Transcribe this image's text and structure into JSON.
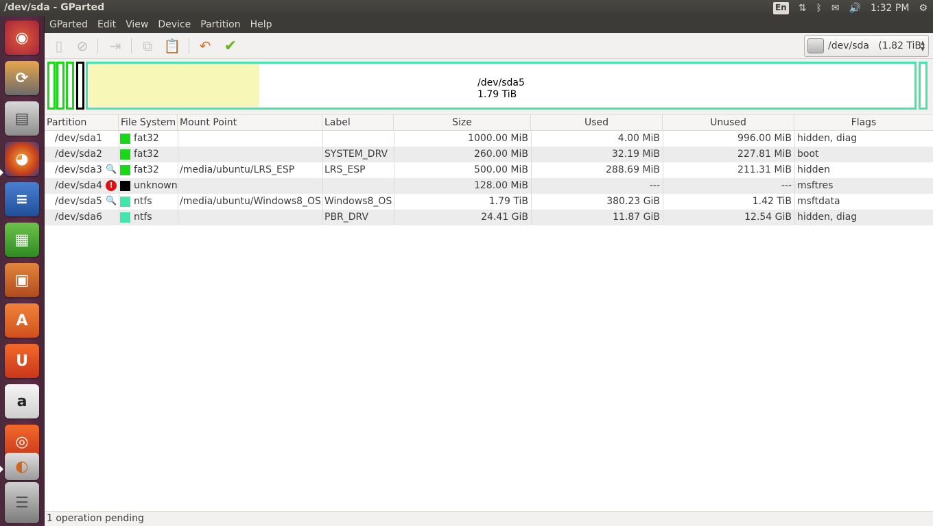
{
  "window_title": "/dev/sda - GParted",
  "indicators": {
    "keyboard": "En",
    "clock": "1:32 PM"
  },
  "menu": [
    "GParted",
    "Edit",
    "View",
    "Device",
    "Partition",
    "Help"
  ],
  "device_selector": {
    "value": "/dev/sda   (1.82 TiB)"
  },
  "disk_map": {
    "selected_name": "/dev/sda5",
    "selected_size": "1.79 TiB"
  },
  "table": {
    "headers": [
      "Partition",
      "File System",
      "Mount Point",
      "Label",
      "Size",
      "Used",
      "Unused",
      "Flags"
    ],
    "rows": [
      {
        "partition": "/dev/sda1",
        "fs": "fat32",
        "fs_color": "#18d818",
        "mount": "",
        "label": "",
        "size": "1000.00 MiB",
        "used": "4.00 MiB",
        "unused": "996.00 MiB",
        "flags": "hidden, diag",
        "icon": ""
      },
      {
        "partition": "/dev/sda2",
        "fs": "fat32",
        "fs_color": "#18d818",
        "mount": "",
        "label": "SYSTEM_DRV",
        "size": "260.00 MiB",
        "used": "32.19 MiB",
        "unused": "227.81 MiB",
        "flags": "boot",
        "icon": ""
      },
      {
        "partition": "/dev/sda3",
        "fs": "fat32",
        "fs_color": "#18d818",
        "mount": "/media/ubuntu/LRS_ESP",
        "label": "LRS_ESP",
        "size": "500.00 MiB",
        "used": "288.69 MiB",
        "unused": "211.31 MiB",
        "flags": "hidden",
        "icon": "key-icon"
      },
      {
        "partition": "/dev/sda4",
        "fs": "unknown",
        "fs_color": "#000000",
        "mount": "",
        "label": "",
        "size": "128.00 MiB",
        "used": "---",
        "unused": "---",
        "flags": "msftres",
        "icon": "warning-icon"
      },
      {
        "partition": "/dev/sda5",
        "fs": "ntfs",
        "fs_color": "#42e5ac",
        "mount": "/media/ubuntu/Windows8_OS",
        "label": "Windows8_OS",
        "size": "1.79 TiB",
        "used": "380.23 GiB",
        "unused": "1.42 TiB",
        "flags": "msftdata",
        "icon": "key-icon"
      },
      {
        "partition": "/dev/sda6",
        "fs": "ntfs",
        "fs_color": "#42e5ac",
        "mount": "",
        "label": "PBR_DRV",
        "size": "24.41 GiB",
        "used": "11.87 GiB",
        "unused": "12.54 GiB",
        "flags": "hidden, diag",
        "icon": ""
      }
    ]
  },
  "status": "1 operation pending"
}
